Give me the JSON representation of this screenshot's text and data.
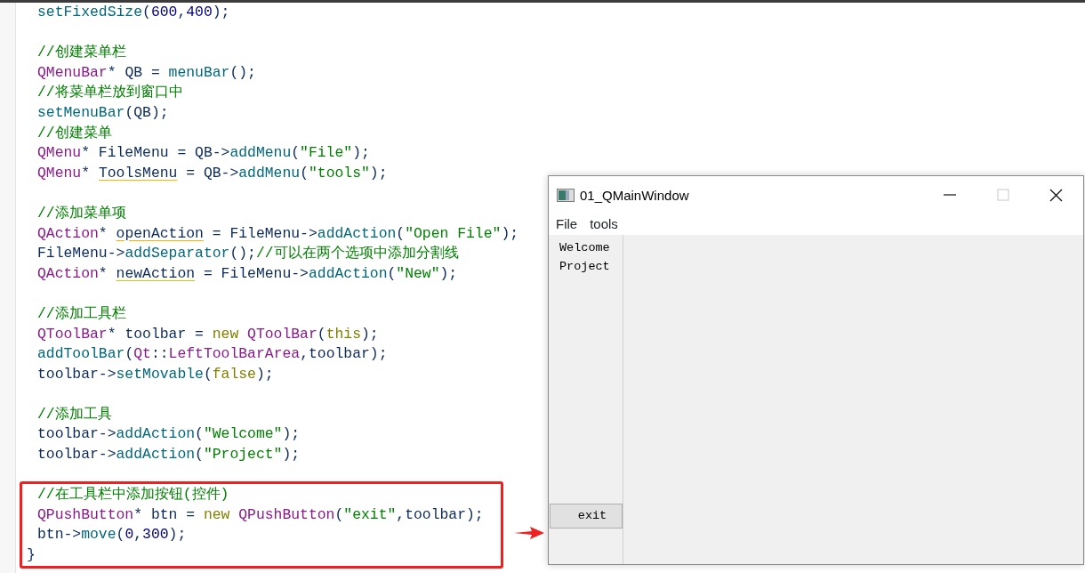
{
  "editor": {
    "blocks": [
      {
        "kind": "plain",
        "lines": [
          {
            "tokens": [
              {
                "text": "setFixedSize",
                "kind": "func"
              },
              {
                "text": "(",
                "kind": "plain"
              },
              {
                "text": "600",
                "kind": "number"
              },
              {
                "text": ",",
                "kind": "plain"
              },
              {
                "text": "400",
                "kind": "number"
              },
              {
                "text": ");",
                "kind": "plain"
              }
            ]
          }
        ]
      },
      {
        "kind": "plain",
        "lines": [
          {
            "tokens": [
              {
                "text": "//创建菜单栏",
                "kind": "comment"
              }
            ]
          },
          {
            "tokens": [
              {
                "text": "QMenuBar",
                "kind": "type"
              },
              {
                "text": "* QB = ",
                "kind": "plain"
              },
              {
                "text": "menuBar",
                "kind": "func"
              },
              {
                "text": "();",
                "kind": "plain"
              }
            ]
          },
          {
            "tokens": [
              {
                "text": "//将菜单栏放到窗口中",
                "kind": "comment"
              }
            ]
          },
          {
            "tokens": [
              {
                "text": "setMenuBar",
                "kind": "func"
              },
              {
                "text": "(QB);",
                "kind": "plain"
              }
            ]
          },
          {
            "tokens": [
              {
                "text": "//创建菜单",
                "kind": "comment"
              }
            ]
          },
          {
            "tokens": [
              {
                "text": "QMenu",
                "kind": "type"
              },
              {
                "text": "* FileMenu = QB->",
                "kind": "plain"
              },
              {
                "text": "addMenu",
                "kind": "func"
              },
              {
                "text": "(",
                "kind": "plain"
              },
              {
                "text": "\"File\"",
                "kind": "string"
              },
              {
                "text": ");",
                "kind": "plain"
              }
            ]
          },
          {
            "tokens": [
              {
                "text": "QMenu",
                "kind": "type"
              },
              {
                "text": "* ",
                "kind": "plain"
              },
              {
                "text": "ToolsMenu",
                "kind": "unused"
              },
              {
                "text": " = QB->",
                "kind": "plain"
              },
              {
                "text": "addMenu",
                "kind": "func"
              },
              {
                "text": "(",
                "kind": "plain"
              },
              {
                "text": "\"tools\"",
                "kind": "string"
              },
              {
                "text": ");",
                "kind": "plain"
              }
            ]
          }
        ]
      },
      {
        "kind": "plain",
        "lines": [
          {
            "tokens": [
              {
                "text": "//添加菜单项",
                "kind": "comment"
              }
            ]
          },
          {
            "tokens": [
              {
                "text": "QAction",
                "kind": "type"
              },
              {
                "text": "* ",
                "kind": "plain"
              },
              {
                "text": "openAction",
                "kind": "unused"
              },
              {
                "text": " = FileMenu->",
                "kind": "plain"
              },
              {
                "text": "addAction",
                "kind": "func"
              },
              {
                "text": "(",
                "kind": "plain"
              },
              {
                "text": "\"Open File\"",
                "kind": "string"
              },
              {
                "text": ");",
                "kind": "plain"
              }
            ]
          },
          {
            "tokens": [
              {
                "text": "FileMenu->",
                "kind": "plain"
              },
              {
                "text": "addSeparator",
                "kind": "func"
              },
              {
                "text": "();",
                "kind": "plain"
              },
              {
                "text": "//可以在两个选项中添加分割线",
                "kind": "comment"
              }
            ]
          },
          {
            "tokens": [
              {
                "text": "QAction",
                "kind": "type"
              },
              {
                "text": "* ",
                "kind": "plain"
              },
              {
                "text": "newAction",
                "kind": "unused"
              },
              {
                "text": " = FileMenu->",
                "kind": "plain"
              },
              {
                "text": "addAction",
                "kind": "func"
              },
              {
                "text": "(",
                "kind": "plain"
              },
              {
                "text": "\"New\"",
                "kind": "string"
              },
              {
                "text": ");",
                "kind": "plain"
              }
            ]
          }
        ]
      },
      {
        "kind": "plain",
        "lines": [
          {
            "tokens": [
              {
                "text": "//添加工具栏",
                "kind": "comment"
              }
            ]
          },
          {
            "tokens": [
              {
                "text": "QToolBar",
                "kind": "type"
              },
              {
                "text": "* toolbar = ",
                "kind": "plain"
              },
              {
                "text": "new",
                "kind": "keyword"
              },
              {
                "text": " QToolBar",
                "kind": "type"
              },
              {
                "text": "(",
                "kind": "plain"
              },
              {
                "text": "this",
                "kind": "keyword"
              },
              {
                "text": ");",
                "kind": "plain"
              }
            ]
          },
          {
            "tokens": [
              {
                "text": "addToolBar",
                "kind": "func"
              },
              {
                "text": "(",
                "kind": "plain"
              },
              {
                "text": "Qt",
                "kind": "type"
              },
              {
                "text": "::",
                "kind": "plain"
              },
              {
                "text": "LeftToolBarArea",
                "kind": "type"
              },
              {
                "text": ",toolbar);",
                "kind": "plain"
              }
            ]
          },
          {
            "tokens": [
              {
                "text": "toolbar->",
                "kind": "plain"
              },
              {
                "text": "setMovable",
                "kind": "func"
              },
              {
                "text": "(",
                "kind": "plain"
              },
              {
                "text": "false",
                "kind": "keyword"
              },
              {
                "text": ");",
                "kind": "plain"
              }
            ]
          }
        ]
      },
      {
        "kind": "plain",
        "lines": [
          {
            "tokens": [
              {
                "text": "//添加工具",
                "kind": "comment"
              }
            ]
          },
          {
            "tokens": [
              {
                "text": "toolbar->",
                "kind": "plain"
              },
              {
                "text": "addAction",
                "kind": "func"
              },
              {
                "text": "(",
                "kind": "plain"
              },
              {
                "text": "\"Welcome\"",
                "kind": "string"
              },
              {
                "text": ");",
                "kind": "plain"
              }
            ]
          },
          {
            "tokens": [
              {
                "text": "toolbar->",
                "kind": "plain"
              },
              {
                "text": "addAction",
                "kind": "func"
              },
              {
                "text": "(",
                "kind": "plain"
              },
              {
                "text": "\"Project\"",
                "kind": "string"
              },
              {
                "text": ");",
                "kind": "plain"
              }
            ]
          }
        ]
      },
      {
        "kind": "callout",
        "lines": [
          {
            "tokens": [
              {
                "text": "//在工具栏中添加按钮(控件)",
                "kind": "comment"
              }
            ]
          },
          {
            "tokens": [
              {
                "text": "QPushButton",
                "kind": "type"
              },
              {
                "text": "* btn = ",
                "kind": "plain"
              },
              {
                "text": "new",
                "kind": "keyword"
              },
              {
                "text": " QPushButton",
                "kind": "type"
              },
              {
                "text": "(",
                "kind": "plain"
              },
              {
                "text": "\"exit\"",
                "kind": "string"
              },
              {
                "text": ",toolbar);",
                "kind": "plain"
              }
            ]
          },
          {
            "tokens": [
              {
                "text": "btn->",
                "kind": "plain"
              },
              {
                "text": "move",
                "kind": "func"
              },
              {
                "text": "(",
                "kind": "plain"
              },
              {
                "text": "0",
                "kind": "number"
              },
              {
                "text": ",",
                "kind": "plain"
              },
              {
                "text": "300",
                "kind": "number"
              },
              {
                "text": ");",
                "kind": "plain"
              }
            ]
          }
        ]
      },
      {
        "kind": "closing",
        "lines": [
          {
            "tokens": [
              {
                "text": "}",
                "kind": "plain"
              }
            ]
          }
        ]
      }
    ]
  },
  "app_window": {
    "title": "01_QMainWindow",
    "title_buttons": [
      {
        "kind": "minimize",
        "disabled": false
      },
      {
        "kind": "maximize",
        "disabled": true
      },
      {
        "kind": "close",
        "disabled": false
      }
    ],
    "menus": [
      "File",
      "tools"
    ],
    "toolbar": {
      "actions": [
        "Welcome",
        "Project"
      ],
      "button": "exit"
    }
  }
}
